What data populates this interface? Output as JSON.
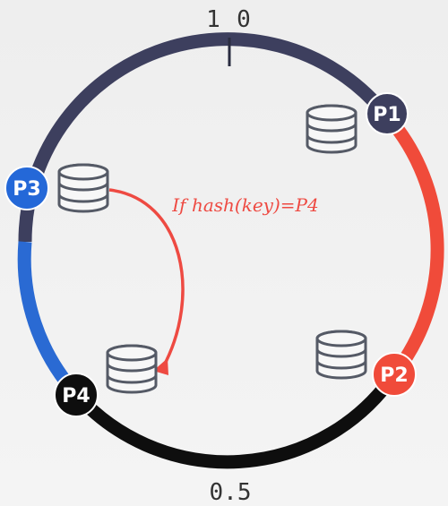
{
  "labels": {
    "top_left": "1",
    "top_right": "0",
    "bottom": "0.5",
    "arrow_text": "If hash(key)=P4"
  },
  "nodes": [
    {
      "id": "p1",
      "label": "P1",
      "color": "#3d3f5e"
    },
    {
      "id": "p2",
      "label": "P2",
      "color": "#f04b3a"
    },
    {
      "id": "p3",
      "label": "P3",
      "color": "#2468d8"
    },
    {
      "id": "p4",
      "label": "P4",
      "color": "#0e0e0e"
    }
  ],
  "colors": {
    "ring_top": "#3d3f5e",
    "ring_right": "#f04b3a",
    "ring_left": "#2a6ad3",
    "ring_bottom": "#0e0e0e",
    "arrow": "#ee4a42",
    "db": "#555a66"
  },
  "icons": [
    "database-icon"
  ]
}
